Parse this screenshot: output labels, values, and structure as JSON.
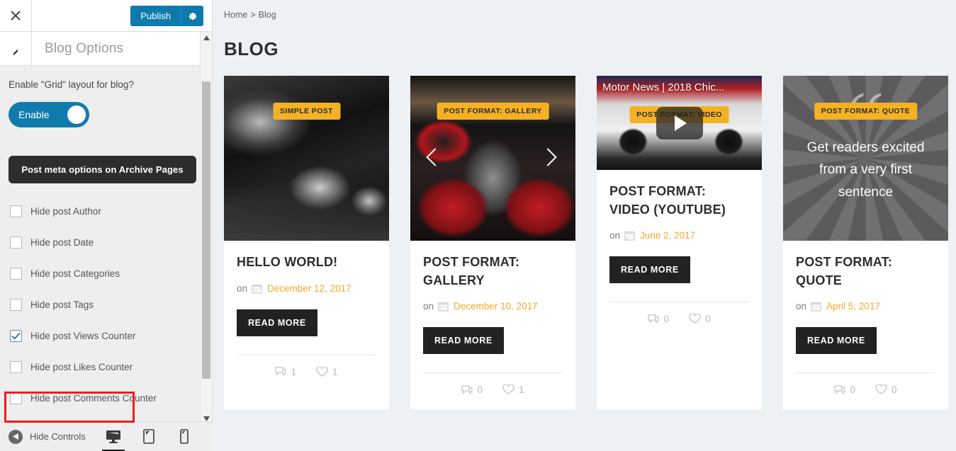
{
  "customizer": {
    "close_label": "Close",
    "publish_label": "Publish",
    "gear_label": "gear",
    "section_title": "Blog Options",
    "grid_question": "Enable \"Grid\" layout for blog?",
    "toggle_label": "Enable",
    "toggle_on": true,
    "meta_section_button": "Post meta options on Archive Pages",
    "checkboxes": [
      {
        "label": "Hide post Author",
        "checked": false
      },
      {
        "label": "Hide post Date",
        "checked": false
      },
      {
        "label": "Hide post Categories",
        "checked": false
      },
      {
        "label": "Hide post Tags",
        "checked": false
      },
      {
        "label": "Hide post Views Counter",
        "checked": true,
        "highlighted": true
      },
      {
        "label": "Hide post Likes Counter",
        "checked": false
      },
      {
        "label": "Hide post Comments Counter",
        "checked": false
      }
    ],
    "footer": {
      "hide_controls_label": "Hide Controls",
      "devices": [
        {
          "name": "desktop",
          "active": true
        },
        {
          "name": "tablet",
          "active": false
        },
        {
          "name": "mobile",
          "active": false
        }
      ]
    },
    "colors": {
      "accent": "#0f7bad",
      "highlight": "#ee1c1c",
      "dark_button": "#2d2d2d"
    }
  },
  "preview": {
    "breadcrumb": {
      "home": "Home",
      "separator": ">",
      "current": "Blog"
    },
    "page_title": "BLOG",
    "colors": {
      "badge": "#f4b223",
      "date": "#f0a92c",
      "button": "#222222"
    },
    "posts": [
      {
        "badge": "SIMPLE POST",
        "title": "HELLO WORLD!",
        "on_label": "on",
        "date": "December 12, 2017",
        "read_more": "READ MORE",
        "comments": "1",
        "likes": "1",
        "media": "image-car-black"
      },
      {
        "badge": "POST FORMAT: GALLERY",
        "title": "POST FORMAT: GALLERY",
        "on_label": "on",
        "date": "December 10, 2017",
        "read_more": "READ MORE",
        "comments": "0",
        "likes": "1",
        "media": "image-car-interior-gallery"
      },
      {
        "badge": "POST FORMAT: VIDEO",
        "title": "POST FORMAT: VIDEO (YOUTUBE)",
        "on_label": "on",
        "date": "June 2, 2017",
        "read_more": "READ MORE",
        "comments": "0",
        "likes": "0",
        "media": "video-youtube",
        "video_title": "Motor News | 2018 Chic..."
      },
      {
        "badge": "POST FORMAT: QUOTE",
        "title": "POST FORMAT: QUOTE",
        "on_label": "on",
        "date": "April 5, 2017",
        "read_more": "READ MORE",
        "comments": "0",
        "likes": "0",
        "media": "image-wheel-quote",
        "quote_text": "Get readers excited from a very first sentence"
      }
    ]
  }
}
